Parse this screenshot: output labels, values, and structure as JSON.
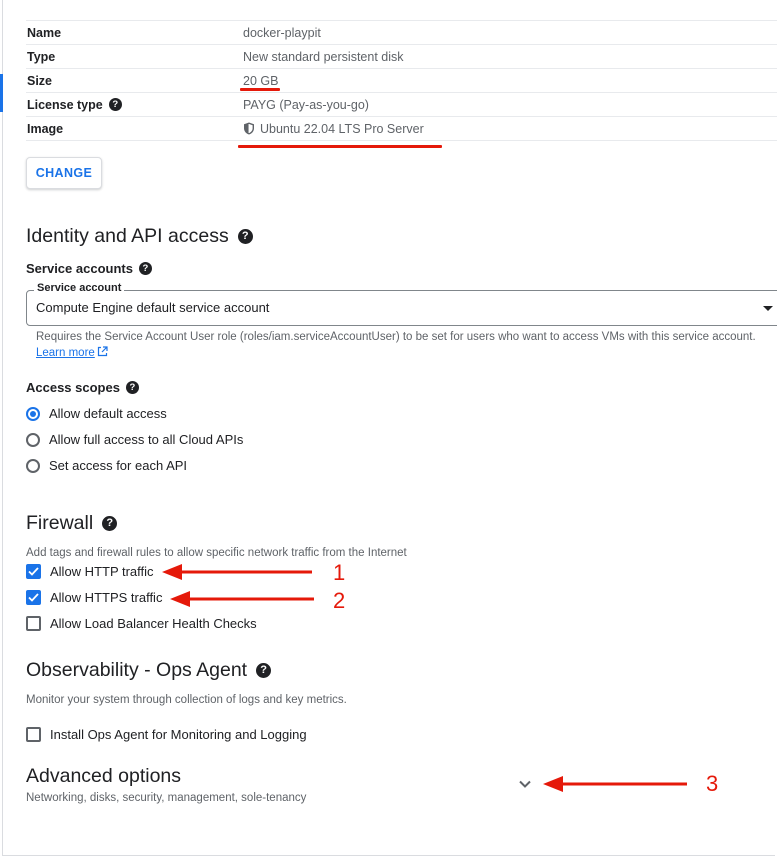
{
  "boot_disk": {
    "rows": [
      {
        "key": "Name",
        "value": "docker-playpit"
      },
      {
        "key": "Type",
        "value": "New standard persistent disk"
      },
      {
        "key": "Size",
        "value": "20 GB"
      },
      {
        "key": "License type",
        "value": "PAYG (Pay-as-you-go)"
      },
      {
        "key": "Image",
        "value": "Ubuntu 22.04 LTS Pro Server"
      }
    ],
    "change_label": "CHANGE"
  },
  "identity": {
    "title": "Identity and API access",
    "service_accounts_label": "Service accounts",
    "service_account_field_label": "Service account",
    "service_account_value": "Compute Engine default service account",
    "hint_text": "Requires the Service Account User role (roles/iam.serviceAccountUser) to be set for users who want to access VMs with this service account.",
    "learn_more": "Learn more",
    "access_scopes_label": "Access scopes",
    "scopes": [
      {
        "label": "Allow default access",
        "selected": true
      },
      {
        "label": "Allow full access to all Cloud APIs",
        "selected": false
      },
      {
        "label": "Set access for each API",
        "selected": false
      }
    ]
  },
  "firewall": {
    "title": "Firewall",
    "description": "Add tags and firewall rules to allow specific network traffic from the Internet",
    "options": [
      {
        "label": "Allow HTTP traffic",
        "checked": true
      },
      {
        "label": "Allow HTTPS traffic",
        "checked": true
      },
      {
        "label": "Allow Load Balancer Health Checks",
        "checked": false
      }
    ]
  },
  "observability": {
    "title": "Observability - Ops Agent",
    "description": "Monitor your system through collection of logs and key metrics.",
    "install_label": "Install Ops Agent for Monitoring and Logging",
    "install_checked": false
  },
  "advanced": {
    "title": "Advanced options",
    "subtitle": "Networking, disks, security, management, sole-tenancy"
  },
  "annotations": {
    "numbers": [
      "1",
      "2",
      "3"
    ],
    "color": "#e5190a"
  },
  "colors": {
    "accent": "#1a73e8",
    "text": "#202124",
    "muted": "#5f6368"
  },
  "icons": {
    "help": "?"
  }
}
